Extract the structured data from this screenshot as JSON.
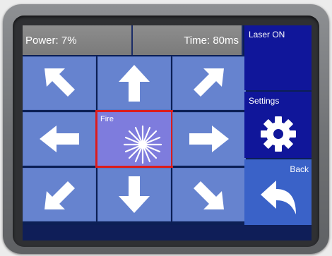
{
  "status_bar": {
    "power": "Power: 7%",
    "time": "Time: 80ms"
  },
  "side_panel": {
    "laser_state": "Laser ON",
    "settings_label": "Settings",
    "back_label": "Back"
  },
  "direction_pad": {
    "fire_label": "Fire",
    "cells": [
      "up-left",
      "up",
      "up-right",
      "left",
      "fire",
      "right",
      "down-left",
      "down",
      "down-right"
    ]
  },
  "colors": {
    "screen_bg": "#0c1f55",
    "cell_bg": "#6683cf",
    "fire_bg": "#7e7cdd",
    "fire_border": "#dc1c1c",
    "status_bg": "#8d8d8d",
    "side_bg": "#10169a",
    "back_bg": "#3a62c8",
    "icon": "#ffffff"
  }
}
